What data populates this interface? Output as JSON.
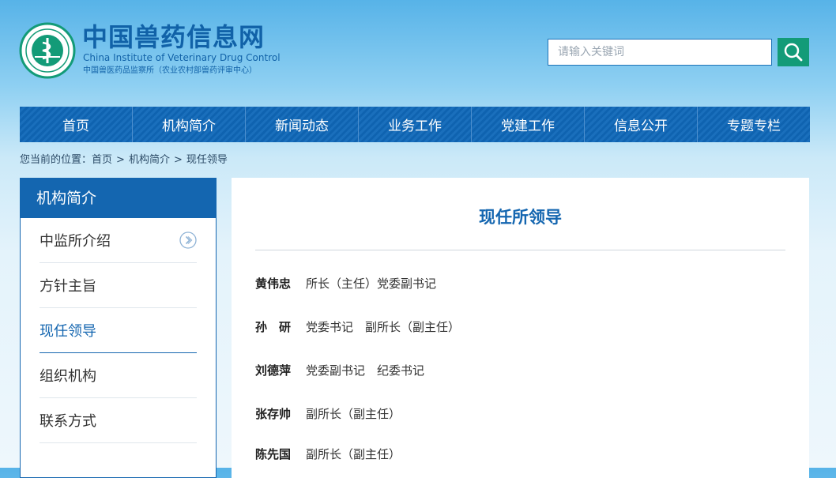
{
  "header": {
    "emblem_icon": "veterinary-emblem-icon",
    "title": "中国兽药信息网",
    "subtitle_en": "China Institute of Veterinary Drug Control",
    "subtitle_cn": "中国兽医药品监察所（农业农村部兽药评审中心）"
  },
  "search": {
    "placeholder": "请输入关键词",
    "button_icon": "search-icon"
  },
  "nav": {
    "items": [
      "首页",
      "机构简介",
      "新闻动态",
      "业务工作",
      "党建工作",
      "信息公开",
      "专题专栏"
    ]
  },
  "breadcrumb": {
    "prefix": "您当前的位置：",
    "items": [
      "首页",
      "机构简介",
      "现任领导"
    ],
    "separator": ">"
  },
  "sidebar": {
    "title": "机构简介",
    "items": [
      "中监所介绍",
      "方针主旨",
      "现任领导",
      "组织机构",
      "联系方式"
    ],
    "active_index": 2
  },
  "content": {
    "heading": "现任所领导",
    "leaders": [
      {
        "name": "黄伟忠",
        "title": "所长（主任）党委副书记"
      },
      {
        "name": "孙　研",
        "title": "党委书记　副所长（副主任）"
      },
      {
        "name": "刘德萍",
        "title": "党委副书记　纪委书记"
      },
      {
        "name": "张存帅",
        "title": "副所长（副主任）"
      },
      {
        "name": "陈先国",
        "title": "副所长（副主任）"
      }
    ]
  },
  "colors": {
    "brand_blue": "#1466b0",
    "search_green": "#139b78"
  }
}
